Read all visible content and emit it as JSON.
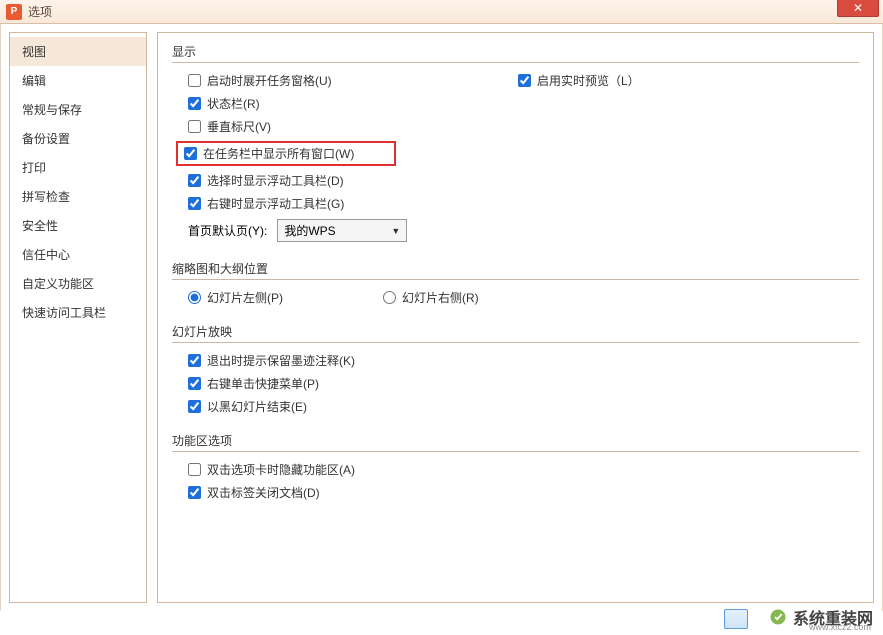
{
  "window": {
    "title": "选项",
    "app_icon_letter": "P"
  },
  "sidebar": {
    "items": [
      {
        "label": "视图",
        "selected": true
      },
      {
        "label": "编辑",
        "selected": false
      },
      {
        "label": "常规与保存",
        "selected": false
      },
      {
        "label": "备份设置",
        "selected": false
      },
      {
        "label": "打印",
        "selected": false
      },
      {
        "label": "拼写检查",
        "selected": false
      },
      {
        "label": "安全性",
        "selected": false
      },
      {
        "label": "信任中心",
        "selected": false
      },
      {
        "label": "自定义功能区",
        "selected": false
      },
      {
        "label": "快速访问工具栏",
        "selected": false
      }
    ]
  },
  "sections": {
    "display": {
      "header": "显示",
      "startup_taskpane": {
        "label": "启动时展开任务窗格(U)",
        "checked": false
      },
      "realtime_preview": {
        "label": "启用实时预览（L）",
        "checked": true
      },
      "status_bar": {
        "label": "状态栏(R)",
        "checked": true
      },
      "vertical_ruler": {
        "label": "垂直标尺(V)",
        "checked": false
      },
      "taskbar_all_windows": {
        "label": "在任务栏中显示所有窗口(W)",
        "checked": true
      },
      "float_toolbar_select": {
        "label": "选择时显示浮动工具栏(D)",
        "checked": true
      },
      "float_toolbar_rightclick": {
        "label": "右键时显示浮动工具栏(G)",
        "checked": true
      },
      "homepage_default": {
        "label": "首页默认页(Y):",
        "value": "我的WPS"
      }
    },
    "thumbnail": {
      "header": "缩略图和大纲位置",
      "option_left": {
        "label": "幻灯片左侧(P)",
        "checked": true
      },
      "option_right": {
        "label": "幻灯片右侧(R)",
        "checked": false
      }
    },
    "slideshow": {
      "header": "幻灯片放映",
      "exit_ink": {
        "label": "退出时提示保留墨迹注释(K)",
        "checked": true
      },
      "rightclick_menu": {
        "label": "右键单击快捷菜单(P)",
        "checked": true
      },
      "end_black": {
        "label": "以黑幻灯片结束(E)",
        "checked": true
      }
    },
    "ribbon": {
      "header": "功能区选项",
      "dblclick_hide": {
        "label": "双击选项卡时隐藏功能区(A)",
        "checked": false
      },
      "dblclick_close": {
        "label": "双击标签关闭文档(D)",
        "checked": true
      }
    }
  },
  "watermark": {
    "text": "系统重装网",
    "url": "www.xtcz2.com"
  }
}
